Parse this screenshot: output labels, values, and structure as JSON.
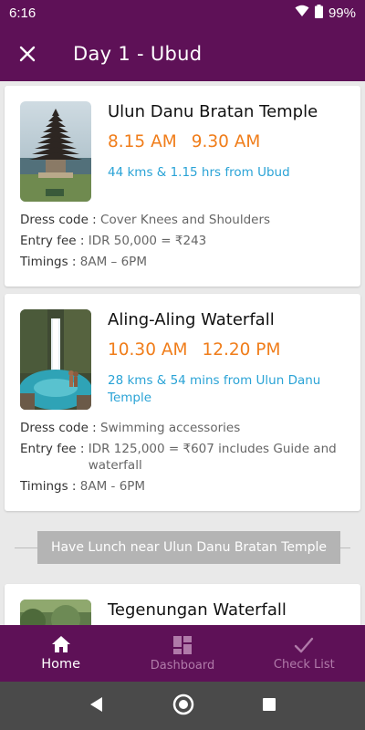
{
  "status_bar": {
    "time": "6:16",
    "battery": "99%"
  },
  "app_bar": {
    "title": "Day 1 -  Ubud"
  },
  "places": [
    {
      "name": "Ulun Danu Bratan Temple",
      "start": "8.15 AM",
      "end": "9.30 AM",
      "distance": "44 kms & 1.15 hrs from Ubud",
      "dress_code_label": "Dress code : ",
      "dress_code": "Cover Knees and Shoulders",
      "entry_fee_label": "Entry fee : ",
      "entry_fee": "IDR 50,000 = ₹243",
      "timings_label": "Timings : ",
      "timings": "8AM – 6PM"
    },
    {
      "name": "Aling-Aling Waterfall",
      "start": "10.30 AM",
      "end": "12.20 PM",
      "distance": "28 kms & 54 mins from Ulun Danu Temple",
      "dress_code_label": "Dress code : ",
      "dress_code": "Swimming accessories",
      "entry_fee_label": "Entry fee : ",
      "entry_fee": "IDR 125,000 = ₹607 includes Guide and waterfall",
      "timings_label": "Timings : ",
      "timings": "8AM - 6PM"
    },
    {
      "name": "Tegenungan Waterfall"
    }
  ],
  "lunch": {
    "label": "Have Lunch near Ulun Danu Bratan Temple"
  },
  "bottom_nav": [
    {
      "label": "Home",
      "icon": "home-icon",
      "active": true
    },
    {
      "label": "Dashboard",
      "icon": "dashboard-icon",
      "active": false
    },
    {
      "label": "Check List",
      "icon": "check-icon",
      "active": false
    }
  ],
  "colors": {
    "primary": "#5e1157",
    "time_orange": "#f07d1a",
    "distance_blue": "#2aa3d6",
    "nav_inactive": "#b07aa9"
  }
}
